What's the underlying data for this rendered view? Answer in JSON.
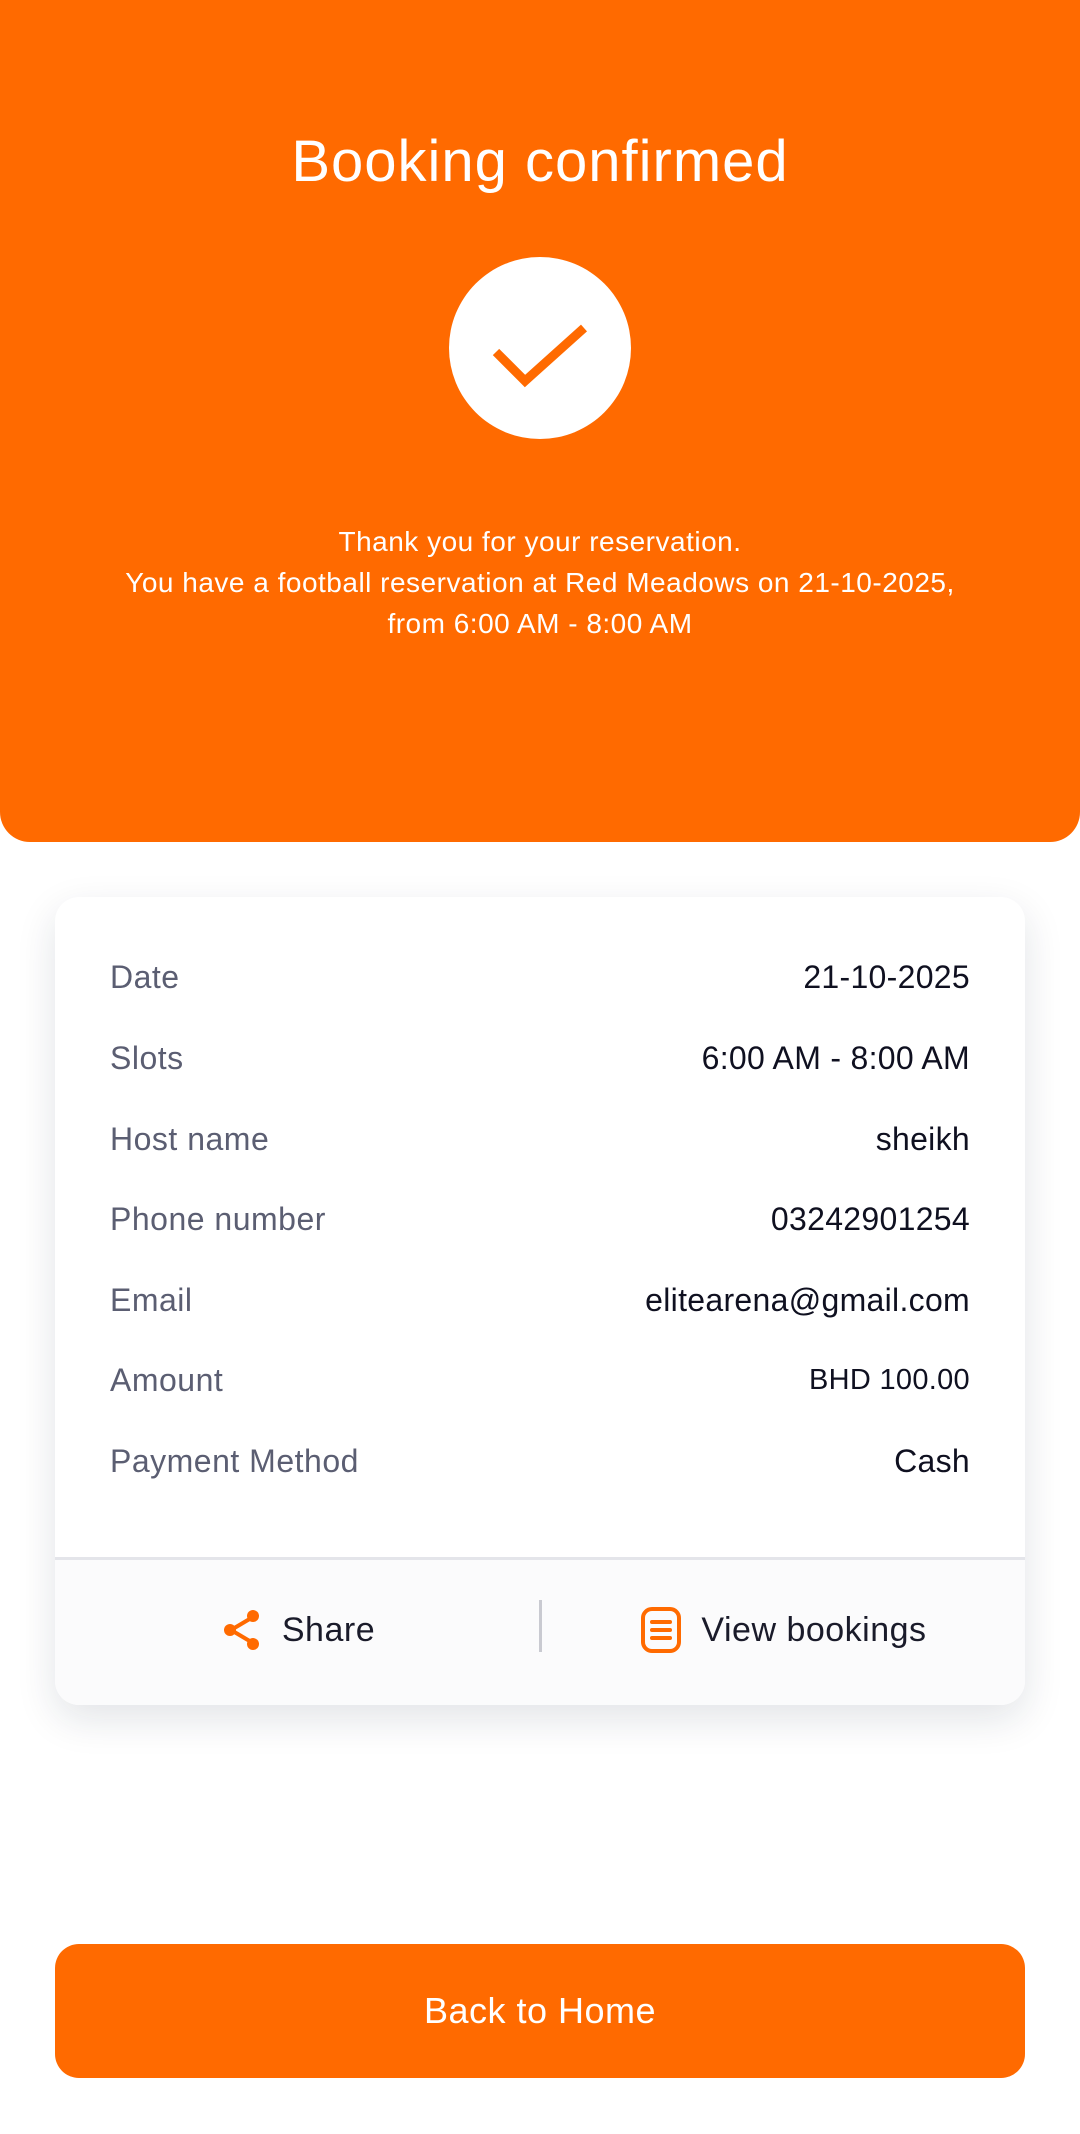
{
  "theme": {
    "accent": "#ff6a00",
    "card_background": "#ffffff",
    "label_color": "#5b5e72",
    "value_color": "#0f1020"
  },
  "header": {
    "title": "Booking confirmed",
    "status_icon": "checkmark-icon",
    "message_line1": "Thank you for your reservation.",
    "message_line2": "You have a football reservation at Red Meadows on 21-10-2025,",
    "message_line3": "from 6:00 AM - 8:00 AM"
  },
  "details": {
    "rows": [
      {
        "label": "Date",
        "value": "21-10-2025"
      },
      {
        "label": "Slots",
        "value": "6:00 AM - 8:00 AM"
      },
      {
        "label": "Host name",
        "value": "sheikh"
      },
      {
        "label": "Phone number",
        "value": "03242901254"
      },
      {
        "label": "Email",
        "value": "elitearena@gmail.com"
      },
      {
        "label": "Amount",
        "value": "BHD 100.00"
      },
      {
        "label": "Payment Method",
        "value": "Cash"
      }
    ]
  },
  "actions": {
    "share_label": "Share",
    "share_icon": "share-icon",
    "view_bookings_label": "View bookings",
    "view_bookings_icon": "document-list-icon"
  },
  "footer": {
    "back_home_label": "Back to Home"
  }
}
